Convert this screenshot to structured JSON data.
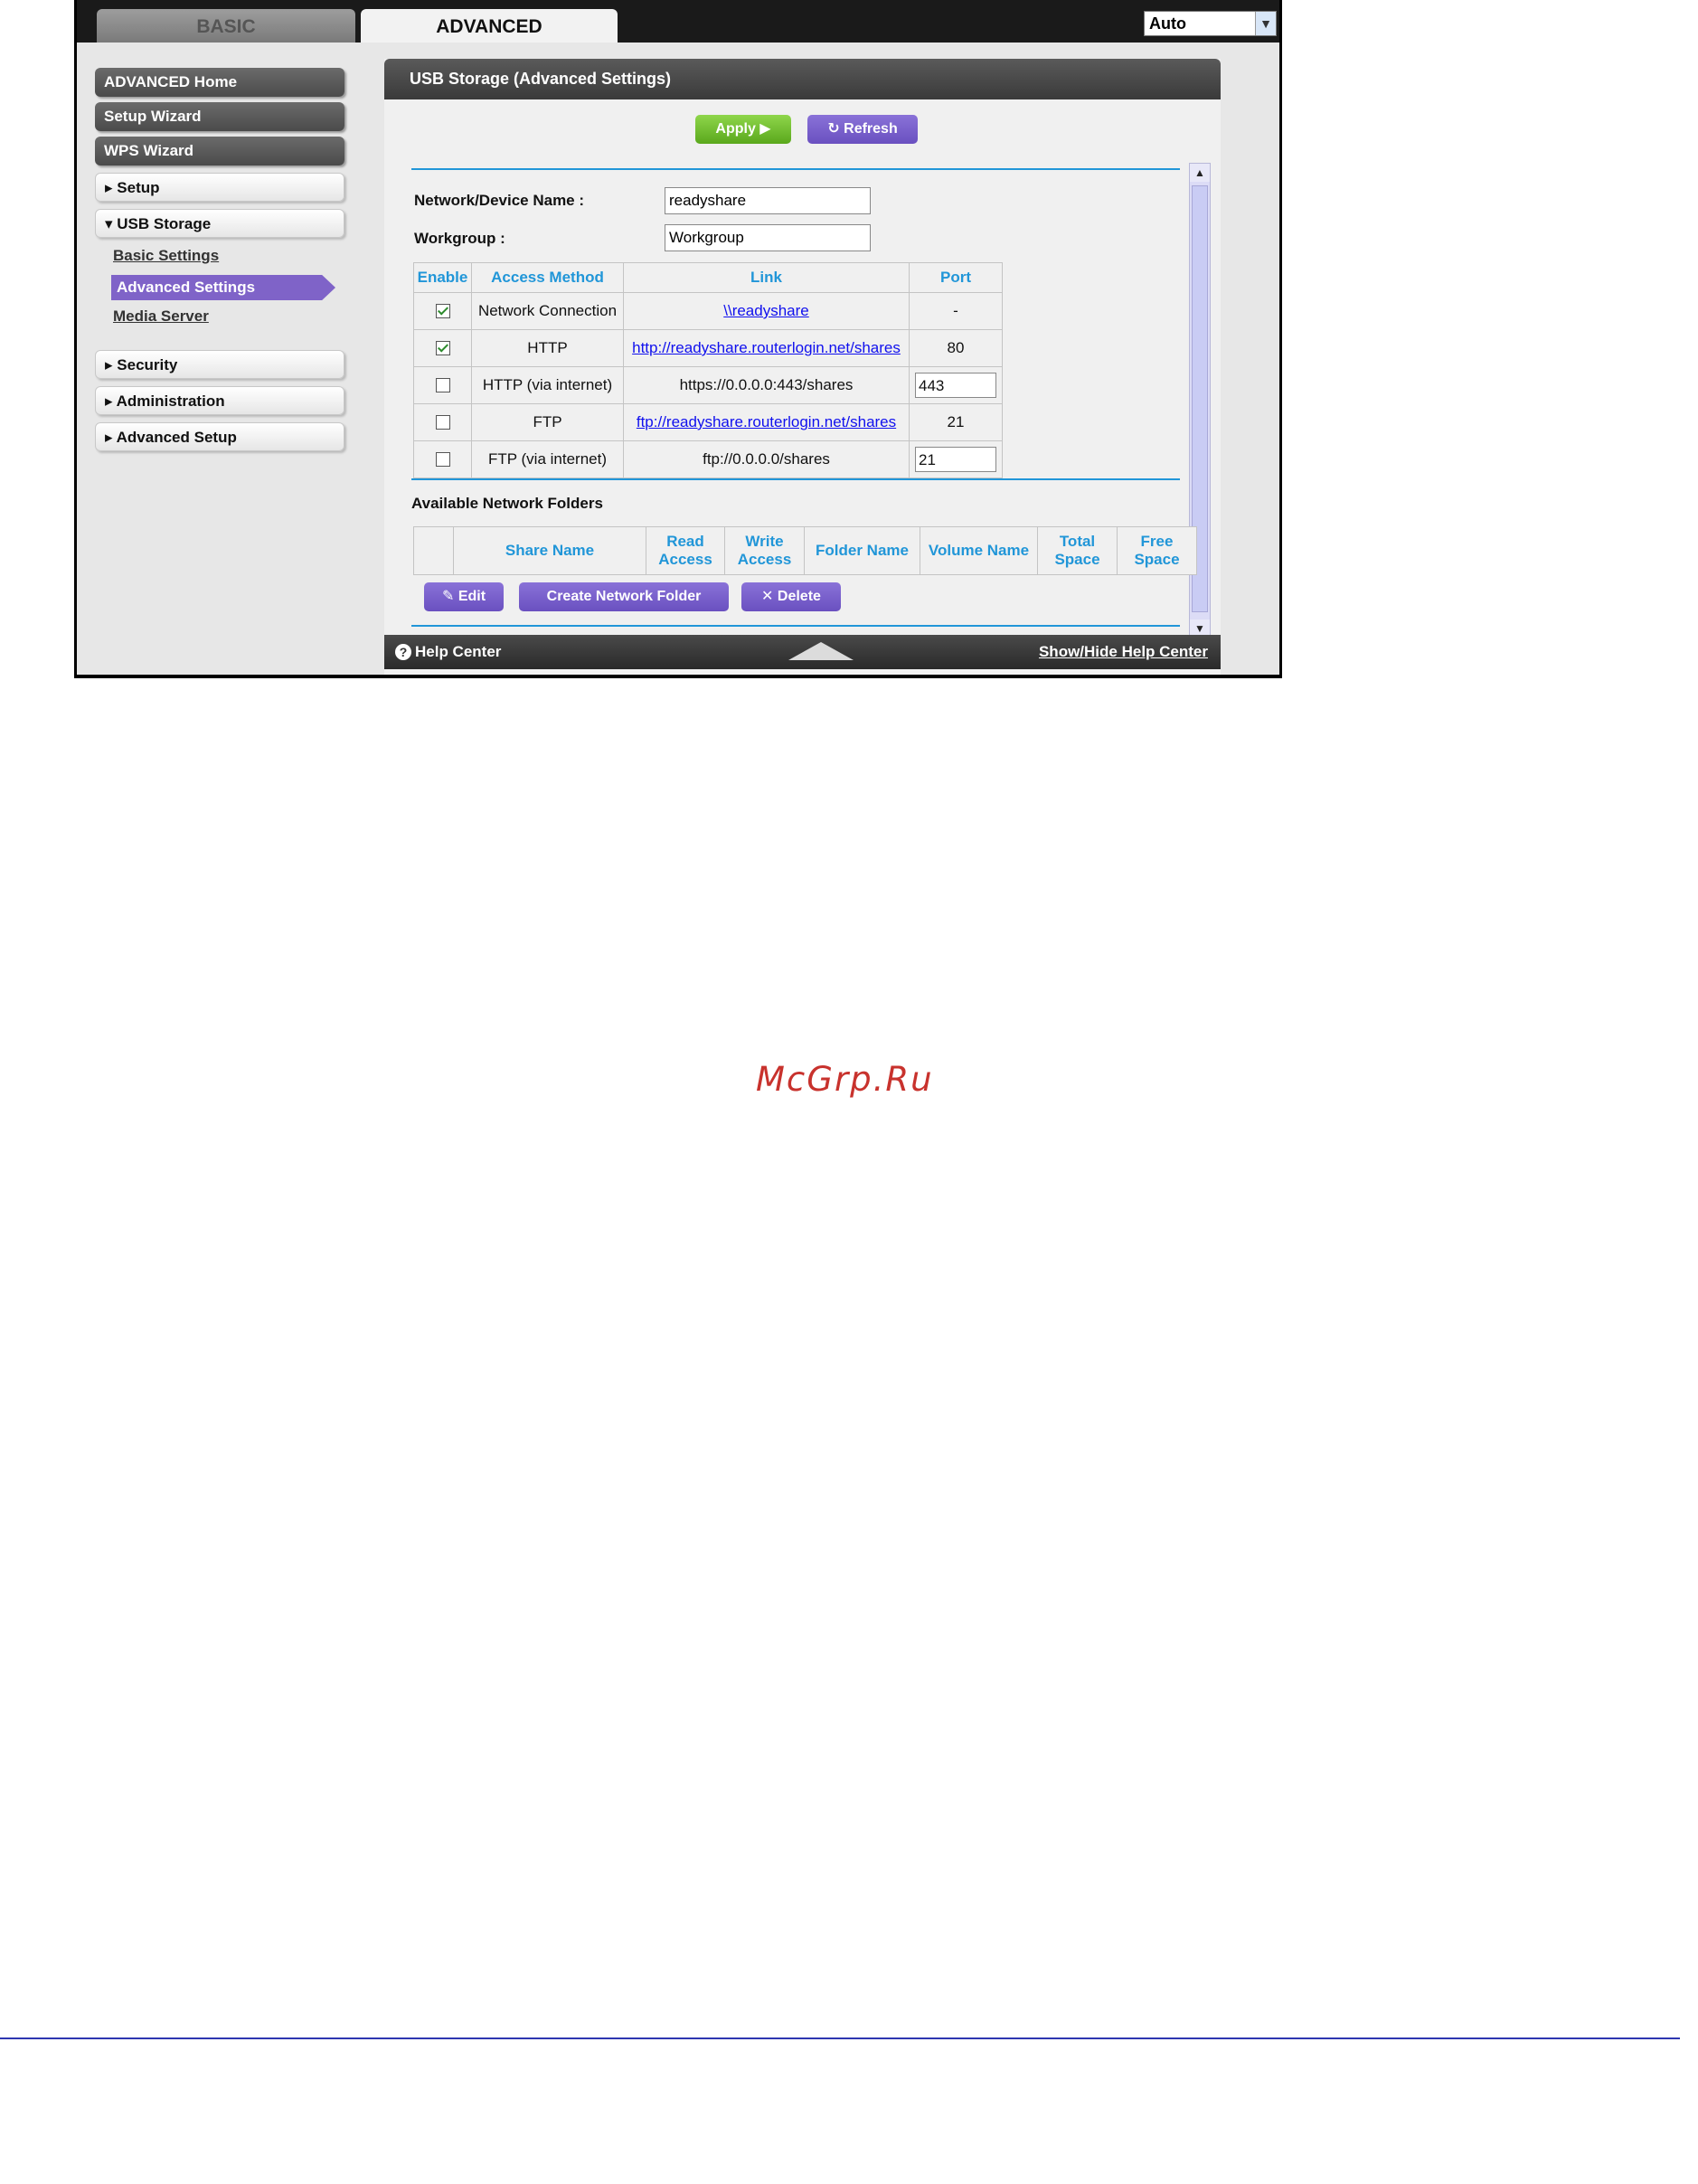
{
  "tabs": {
    "basic": "BASIC",
    "advanced": "ADVANCED"
  },
  "language": {
    "selected": "Auto"
  },
  "sidebar": {
    "advanced_home": "ADVANCED Home",
    "setup_wizard": "Setup Wizard",
    "wps_wizard": "WPS Wizard",
    "setup": "Setup",
    "usb_storage": "USB Storage",
    "basic_settings": "Basic Settings",
    "advanced_settings": "Advanced Settings",
    "media_server": "Media Server",
    "security": "Security",
    "administration": "Administration",
    "advanced_setup": "Advanced Setup"
  },
  "panel": {
    "title": "USB Storage (Advanced Settings)",
    "apply": "Apply",
    "refresh": "Refresh",
    "device_name_label": "Network/Device Name :",
    "device_name_value": "readyshare",
    "workgroup_label": "Workgroup :",
    "workgroup_value": "Workgroup"
  },
  "access_table": {
    "headers": [
      "Enable",
      "Access Method",
      "Link",
      "Port"
    ],
    "rows": [
      {
        "enabled": true,
        "method": "Network Connection",
        "link": "\\\\readyshare",
        "link_is_url": true,
        "port": "-"
      },
      {
        "enabled": true,
        "method": "HTTP",
        "link": "http://readyshare.routerlogin.net/shares",
        "link_is_url": true,
        "port": "80"
      },
      {
        "enabled": false,
        "method": "HTTP (via internet)",
        "link": "https://0.0.0.0:443/shares",
        "link_is_url": false,
        "port": "443"
      },
      {
        "enabled": false,
        "method": "FTP",
        "link": "ftp://readyshare.routerlogin.net/shares",
        "link_is_url": true,
        "port": "21"
      },
      {
        "enabled": false,
        "method": "FTP (via internet)",
        "link": "ftp://0.0.0.0/shares",
        "link_is_url": false,
        "port": "21"
      }
    ]
  },
  "folders": {
    "title": "Available Network Folders",
    "headers": [
      "",
      "Share Name",
      "Read Access",
      "Write Access",
      "Folder Name",
      "Volume Name",
      "Total Space",
      "Free Space"
    ],
    "edit": "Edit",
    "create": "Create Network Folder",
    "delete": "Delete"
  },
  "help": {
    "label": "Help Center",
    "toggle": "Show/Hide Help Center"
  },
  "watermark": "McGrp.Ru"
}
